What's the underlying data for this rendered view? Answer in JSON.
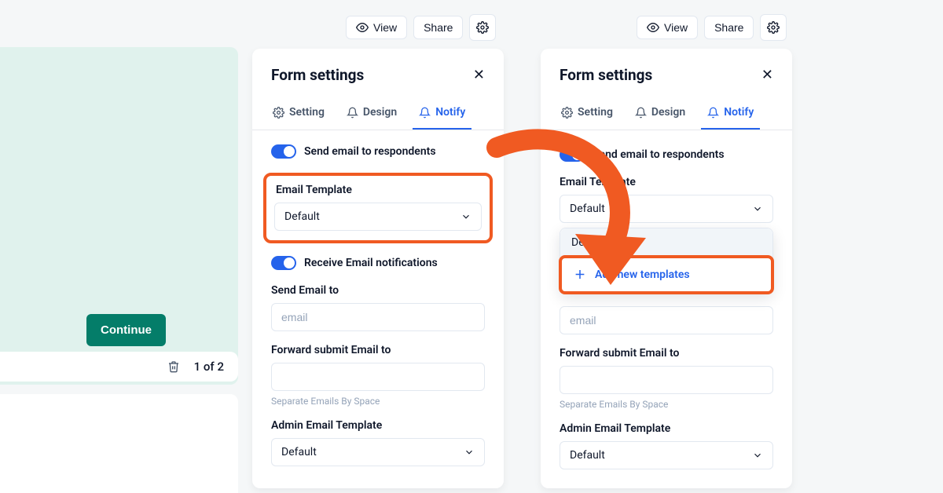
{
  "toolbar": {
    "view_label": "View",
    "share_label": "Share"
  },
  "panel": {
    "title": "Form settings",
    "tabs": {
      "setting": "Setting",
      "design": "Design",
      "notify": "Notify"
    },
    "send_email_respondents": "Send email to respondents",
    "email_template_label": "Email Template",
    "email_template_value": "Default",
    "receive_notifications": "Receive Email notifications",
    "send_email_to_label": "Send Email to",
    "email_placeholder": "email",
    "forward_label": "Forward submit Email to",
    "separate_helper": "Separate Emails By Space",
    "admin_template_label": "Admin Email Template",
    "admin_template_value": "Default"
  },
  "panel_right_extra": {
    "dropdown_default": "Default",
    "add_new_templates": "Add new templates"
  },
  "left": {
    "continue": "Continue",
    "page_count": "1 of 2"
  },
  "colors": {
    "accent_blue": "#2563eb",
    "highlight_orange": "#f05a22",
    "green_btn": "#047d69"
  }
}
